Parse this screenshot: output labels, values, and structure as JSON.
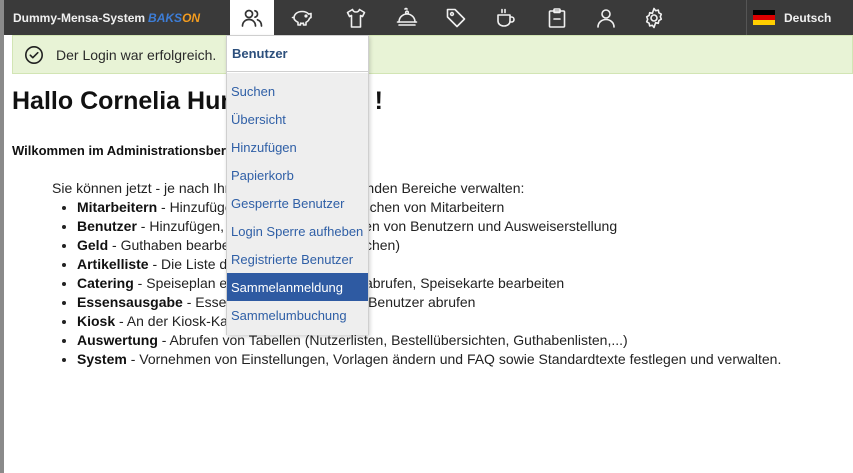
{
  "brand": {
    "name": "Dummy-Mensa-System",
    "logo_part1": "BAKS",
    "logo_part2": "ON"
  },
  "nav": {
    "icons": [
      "users-icon",
      "piggy-bank-icon",
      "shirt-icon",
      "cloche-icon",
      "tag-icon",
      "coffee-cup-icon",
      "clipboard-icon",
      "user-icon",
      "gear-icon"
    ],
    "active_index": 0
  },
  "language": {
    "label": "Deutsch",
    "flag_colors": [
      "#000000",
      "#dd0000",
      "#ffce00"
    ]
  },
  "alert": {
    "text": "Der Login war erfolgreich."
  },
  "main": {
    "greeting": "Hallo Cornelia Hundertwasser !",
    "welcome": "Wilkommen im Administrationsbereich",
    "intro": "Sie können jetzt - je nach Ihren Rechten - die folgenden Bereiche verwalten:",
    "areas": [
      {
        "title": "Mitarbeitern",
        "desc": " - Hinzufügen, Bearbeiten und Löschen von Mitarbeitern"
      },
      {
        "title": "Benutzer",
        "desc": " - Hinzufügen, Bearbeiten und Löschen von Benutzern und Ausweiserstellung"
      },
      {
        "title": "Geld",
        "desc": " - Guthaben bearbeiten (Einzahlungen buchen)"
      },
      {
        "title": "Artikelliste",
        "desc": " - Die Liste der Artikel bearbeiten"
      },
      {
        "title": "Catering",
        "desc": " - Speiseplan erstellen, Bestellungen abrufen, Speisekarte bearbeiten"
      },
      {
        "title": "Essensausgabe",
        "desc": " - Essensausgabe, Daten der Benutzer abrufen"
      },
      {
        "title": "Kiosk",
        "desc": " - An der Kiosk-Kasse verkaufen"
      },
      {
        "title": "Auswertung",
        "desc": " - Abrufen von Tabellen (Nutzerlisten, Bestellübersichten, Guthabenlisten,...)"
      },
      {
        "title": "System",
        "desc": " - Vornehmen von Einstellungen, Vorlagen ändern und FAQ sowie Standardtexte festlegen und verwalten."
      }
    ]
  },
  "dropdown": {
    "header": "Benutzer",
    "items": [
      "Suchen",
      "Übersicht",
      "Hinzufügen",
      "Papierkorb",
      "Gesperrte Benutzer",
      "Login Sperre aufheben",
      "Registrierte Benutzer",
      "Sammelanmeldung",
      "Sammelumbuchung"
    ],
    "selected": "Sammelanmeldung"
  },
  "colors": {
    "topbar": "#3a3a3a",
    "alert_bg": "#e8f3d6",
    "link": "#2f5fa6",
    "selected": "#2e5aa2"
  }
}
